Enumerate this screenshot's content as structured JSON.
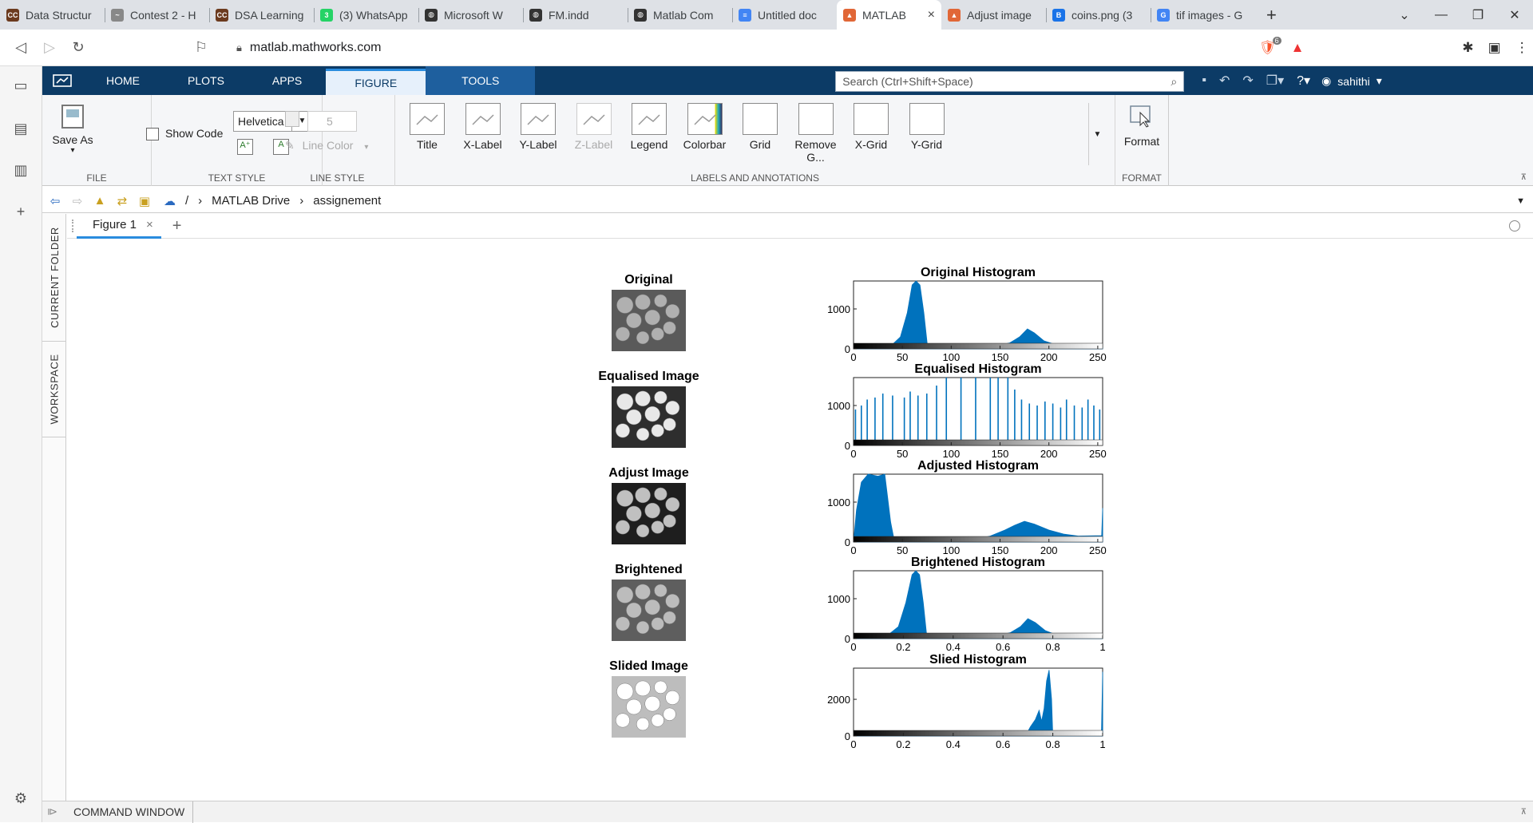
{
  "browser": {
    "tabs": [
      {
        "title": "Data Structur",
        "fav": "CC",
        "color": "#6b3a1e"
      },
      {
        "title": "Contest 2 - H",
        "fav": "~",
        "color": "#888888"
      },
      {
        "title": "DSA Learning",
        "fav": "CC",
        "color": "#6b3a1e"
      },
      {
        "title": "(3) WhatsApp",
        "fav": "3",
        "color": "#25d366"
      },
      {
        "title": "Microsoft W",
        "fav": "◍",
        "color": "#333333"
      },
      {
        "title": "FM.indd",
        "fav": "◍",
        "color": "#333333"
      },
      {
        "title": "Matlab Com",
        "fav": "◍",
        "color": "#333333"
      },
      {
        "title": "Untitled doc",
        "fav": "≡",
        "color": "#4285f4"
      },
      {
        "title": "MATLAB",
        "fav": "▲",
        "color": "#e16737",
        "active": true
      },
      {
        "title": "Adjust image",
        "fav": "▲",
        "color": "#e16737"
      },
      {
        "title": "coins.png (3",
        "fav": "B",
        "color": "#1a73e8"
      },
      {
        "title": "tif images - G",
        "fav": "G",
        "color": "#4285f4"
      }
    ],
    "new_tab": "+",
    "close": "×",
    "url": "matlab.mathworks.com",
    "brave_badge": "6"
  },
  "matlab": {
    "tabs": [
      "HOME",
      "PLOTS",
      "APPS",
      "FIGURE",
      "TOOLS"
    ],
    "search_placeholder": "Search (Ctrl+Shift+Space)",
    "user": "sahithi",
    "file": {
      "save_as": "Save As",
      "group": "FILE"
    },
    "text_style": {
      "font": "Helvetica",
      "show_code": "Show Code",
      "group": "TEXT STYLE"
    },
    "line_style": {
      "width": "5",
      "line_color": "Line Color",
      "group": "LINE STYLE"
    },
    "labels": {
      "buttons": [
        "Title",
        "X-Label",
        "Y-Label",
        "Z-Label",
        "Legend",
        "Colorbar",
        "Grid",
        "Remove G...",
        "X-Grid",
        "Y-Grid"
      ],
      "group": "LABELS AND ANNOTATIONS"
    },
    "format": {
      "button": "Format",
      "group": "FORMAT"
    },
    "path": [
      "/",
      "MATLAB Drive",
      "assignement"
    ],
    "side_tabs": [
      "CURRENT FOLDER",
      "WORKSPACE"
    ],
    "figure_tab": "Figure 1",
    "command_window": "COMMAND WINDOW"
  },
  "figure": {
    "images": [
      {
        "title": "Original",
        "tone": "orig"
      },
      {
        "title": "Equalised Image",
        "tone": "eq"
      },
      {
        "title": "Adjust Image",
        "tone": "adj"
      },
      {
        "title": "Brightened",
        "tone": "bright"
      },
      {
        "title": "Slided Image",
        "tone": "slide"
      }
    ]
  },
  "chart_data": [
    {
      "type": "bar",
      "title": "Original Histogram",
      "xlim": [
        0,
        255
      ],
      "ylim": [
        0,
        1700
      ],
      "xticks": [
        "0",
        "50",
        "100",
        "150",
        "200",
        "250"
      ],
      "xtick_values": [
        0,
        50,
        100,
        150,
        200,
        250
      ],
      "yticks": [
        "0",
        "1000"
      ],
      "ytick_values": [
        0,
        1000
      ],
      "color": "#0072bd",
      "profile": [
        [
          0,
          0
        ],
        [
          35,
          0
        ],
        [
          48,
          300
        ],
        [
          55,
          900
        ],
        [
          60,
          1600
        ],
        [
          64,
          1700
        ],
        [
          68,
          1600
        ],
        [
          72,
          900
        ],
        [
          76,
          0
        ],
        [
          140,
          40
        ],
        [
          160,
          150
        ],
        [
          170,
          300
        ],
        [
          178,
          500
        ],
        [
          185,
          400
        ],
        [
          195,
          200
        ],
        [
          210,
          80
        ],
        [
          230,
          40
        ],
        [
          255,
          20
        ]
      ]
    },
    {
      "type": "bar",
      "title": "Equalised Histogram",
      "xlim": [
        0,
        255
      ],
      "ylim": [
        0,
        1700
      ],
      "xticks": [
        "0",
        "50",
        "100",
        "150",
        "200",
        "250"
      ],
      "xtick_values": [
        0,
        50,
        100,
        150,
        200,
        250
      ],
      "yticks": [
        "0",
        "1000"
      ],
      "ytick_values": [
        0,
        1000
      ],
      "color": "#0072bd",
      "stems": [
        [
          2,
          900
        ],
        [
          8,
          1000
        ],
        [
          14,
          1150
        ],
        [
          22,
          1200
        ],
        [
          30,
          1300
        ],
        [
          40,
          1250
        ],
        [
          52,
          1200
        ],
        [
          58,
          1350
        ],
        [
          66,
          1250
        ],
        [
          75,
          1300
        ],
        [
          85,
          1500
        ],
        [
          95,
          1750
        ],
        [
          110,
          1750
        ],
        [
          125,
          1700
        ],
        [
          140,
          1700
        ],
        [
          148,
          1750
        ],
        [
          158,
          1750
        ],
        [
          165,
          1400
        ],
        [
          172,
          1150
        ],
        [
          180,
          1050
        ],
        [
          188,
          1000
        ],
        [
          196,
          1100
        ],
        [
          204,
          1050
        ],
        [
          212,
          950
        ],
        [
          218,
          1150
        ],
        [
          226,
          1000
        ],
        [
          234,
          950
        ],
        [
          240,
          1150
        ],
        [
          246,
          1000
        ],
        [
          252,
          900
        ]
      ]
    },
    {
      "type": "bar",
      "title": "Adjusted Histogram",
      "xlim": [
        0,
        255
      ],
      "ylim": [
        0,
        1700
      ],
      "xticks": [
        "0",
        "50",
        "100",
        "150",
        "200",
        "250"
      ],
      "xtick_values": [
        0,
        50,
        100,
        150,
        200,
        250
      ],
      "yticks": [
        "0",
        "1000"
      ],
      "ytick_values": [
        0,
        1000
      ],
      "color": "#0072bd",
      "profile": [
        [
          0,
          0
        ],
        [
          3,
          800
        ],
        [
          8,
          1500
        ],
        [
          15,
          1700
        ],
        [
          25,
          1650
        ],
        [
          32,
          1700
        ],
        [
          38,
          500
        ],
        [
          42,
          0
        ],
        [
          120,
          40
        ],
        [
          140,
          150
        ],
        [
          155,
          300
        ],
        [
          165,
          420
        ],
        [
          175,
          520
        ],
        [
          185,
          450
        ],
        [
          200,
          300
        ],
        [
          215,
          200
        ],
        [
          230,
          150
        ],
        [
          254,
          160
        ],
        [
          255,
          850
        ]
      ]
    },
    {
      "type": "bar",
      "title": "Brightened Histogram",
      "xlim": [
        0,
        1
      ],
      "ylim": [
        0,
        1700
      ],
      "xticks": [
        "0",
        "0.2",
        "0.4",
        "0.6",
        "0.8",
        "1"
      ],
      "xtick_values": [
        0,
        0.2,
        0.4,
        0.6,
        0.8,
        1
      ],
      "yticks": [
        "0",
        "1000"
      ],
      "ytick_values": [
        0,
        1000
      ],
      "color": "#0072bd",
      "profile": [
        [
          0,
          0
        ],
        [
          0.12,
          0
        ],
        [
          0.18,
          300
        ],
        [
          0.21,
          900
        ],
        [
          0.235,
          1600
        ],
        [
          0.25,
          1700
        ],
        [
          0.265,
          1600
        ],
        [
          0.28,
          900
        ],
        [
          0.295,
          0
        ],
        [
          0.55,
          40
        ],
        [
          0.63,
          150
        ],
        [
          0.67,
          300
        ],
        [
          0.7,
          500
        ],
        [
          0.73,
          400
        ],
        [
          0.77,
          200
        ],
        [
          0.82,
          80
        ],
        [
          0.9,
          40
        ],
        [
          1,
          20
        ]
      ]
    },
    {
      "type": "bar",
      "title": "Slied Histogram",
      "xlim": [
        0,
        1
      ],
      "ylim": [
        0,
        3700
      ],
      "xticks": [
        "0",
        "0.2",
        "0.4",
        "0.6",
        "0.8",
        "1"
      ],
      "xtick_values": [
        0,
        0.2,
        0.4,
        0.6,
        0.8,
        1
      ],
      "yticks": [
        "0",
        "2000"
      ],
      "ytick_values": [
        0,
        2000
      ],
      "color": "#0072bd",
      "profile": [
        [
          0,
          0
        ],
        [
          0.69,
          0
        ],
        [
          0.71,
          500
        ],
        [
          0.73,
          900
        ],
        [
          0.745,
          1400
        ],
        [
          0.755,
          800
        ],
        [
          0.765,
          1500
        ],
        [
          0.775,
          3000
        ],
        [
          0.785,
          3600
        ],
        [
          0.795,
          2000
        ],
        [
          0.8,
          0
        ],
        [
          0.995,
          0
        ],
        [
          1,
          3500
        ]
      ]
    }
  ]
}
